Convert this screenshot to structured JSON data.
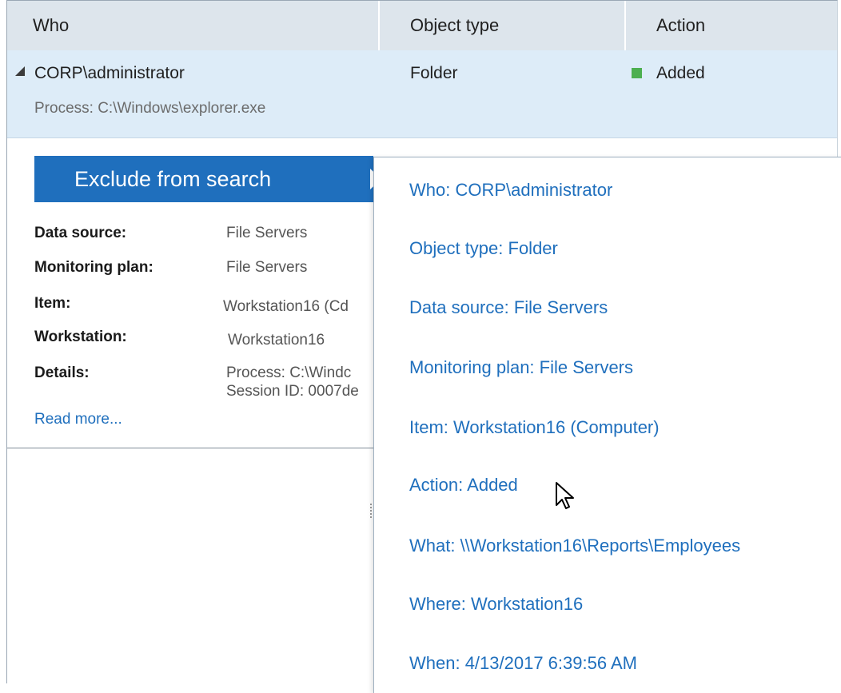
{
  "header": {
    "columns": [
      "Who",
      "Object type",
      "Action"
    ]
  },
  "row": {
    "who": "CORP\\administrator",
    "process": "Process: C:\\Windows\\explorer.exe",
    "object_type": "Folder",
    "action": "Added",
    "action_color": "#4caf50"
  },
  "detail": {
    "exclude_label": "Exclude from search",
    "fields": [
      {
        "label": "Data source:",
        "value": "File Servers"
      },
      {
        "label": "Monitoring plan:",
        "value": "File Servers"
      },
      {
        "label": "Item:",
        "value": "Workstation16 (Cd"
      },
      {
        "label": "Workstation:",
        "value": "Workstation16"
      },
      {
        "label": "Details:",
        "value": "Process: C:\\Windc",
        "value2": "Session ID: 0007de"
      }
    ],
    "read_more": "Read more..."
  },
  "menu": {
    "items": [
      "Who: CORP\\administrator",
      "Object type: Folder",
      "Data source: File Servers",
      "Monitoring plan: File Servers",
      "Item: Workstation16 (Computer)",
      "Action: Added",
      "What: \\\\Workstation16\\Reports\\Employees",
      "Where: Workstation16",
      "When: 4/13/2017 6:39:56 AM"
    ]
  },
  "colors": {
    "accent": "#1f6fbd",
    "header_bg": "#dde5ec",
    "selected_row_bg": "#ddecf8"
  }
}
